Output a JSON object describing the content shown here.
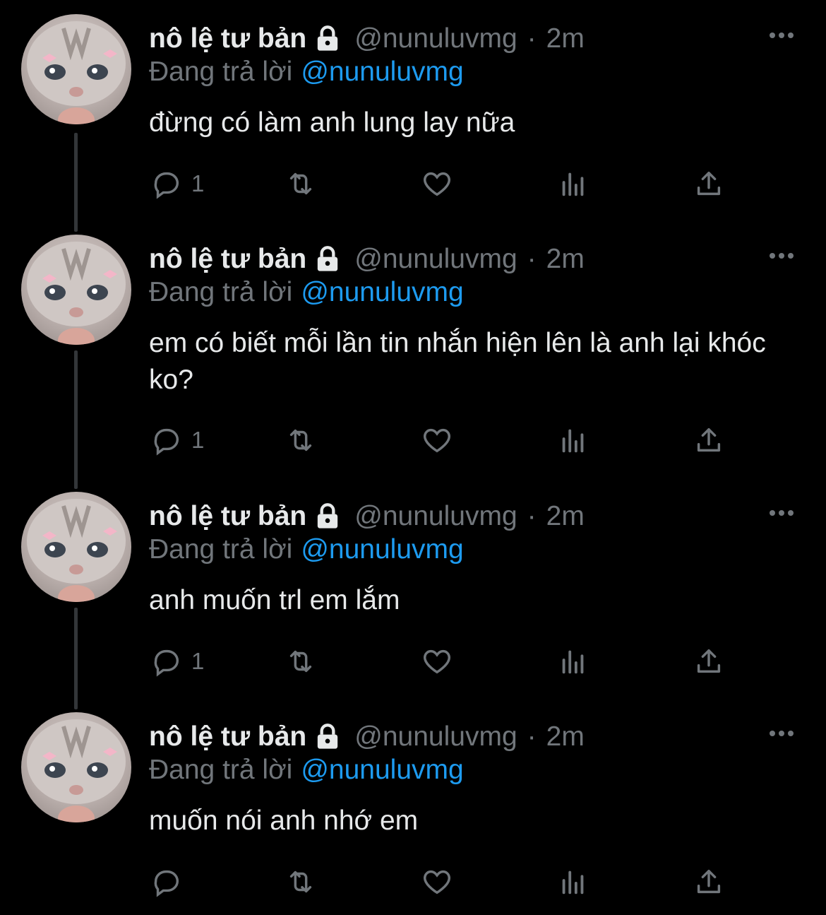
{
  "colors": {
    "background": "#000000",
    "text_primary": "#e7e9ea",
    "text_secondary": "#71767b",
    "link": "#1d9bf0",
    "thread_line": "#333639"
  },
  "tweets": [
    {
      "author_name": "nô lệ tư bản",
      "handle": "@nunuluvmg",
      "separator": "·",
      "time": "2m",
      "reply_prefix": "Đang trả lời",
      "reply_mention": "@nunuluvmg",
      "text": "đừng có làm anh lung lay nữa",
      "reply_count": "1"
    },
    {
      "author_name": "nô lệ tư bản",
      "handle": "@nunuluvmg",
      "separator": "·",
      "time": "2m",
      "reply_prefix": "Đang trả lời",
      "reply_mention": "@nunuluvmg",
      "text": "em có biết mỗi lần tin nhắn hiện lên là anh lại khóc ko?",
      "reply_count": "1"
    },
    {
      "author_name": "nô lệ tư bản",
      "handle": "@nunuluvmg",
      "separator": "·",
      "time": "2m",
      "reply_prefix": "Đang trả lời",
      "reply_mention": "@nunuluvmg",
      "text": "anh muốn trl em lắm",
      "reply_count": "1"
    },
    {
      "author_name": "nô lệ tư bản",
      "handle": "@nunuluvmg",
      "separator": "·",
      "time": "2m",
      "reply_prefix": "Đang trả lời",
      "reply_mention": "@nunuluvmg",
      "text": "muốn nói anh nhớ em",
      "reply_count": ""
    }
  ],
  "icons": {
    "avatar": "kitten-avatar",
    "protected": "lock-icon",
    "more": "more-icon",
    "reply": "reply-icon",
    "retweet": "retweet-icon",
    "like": "like-icon",
    "views": "views-icon",
    "share": "share-icon"
  }
}
